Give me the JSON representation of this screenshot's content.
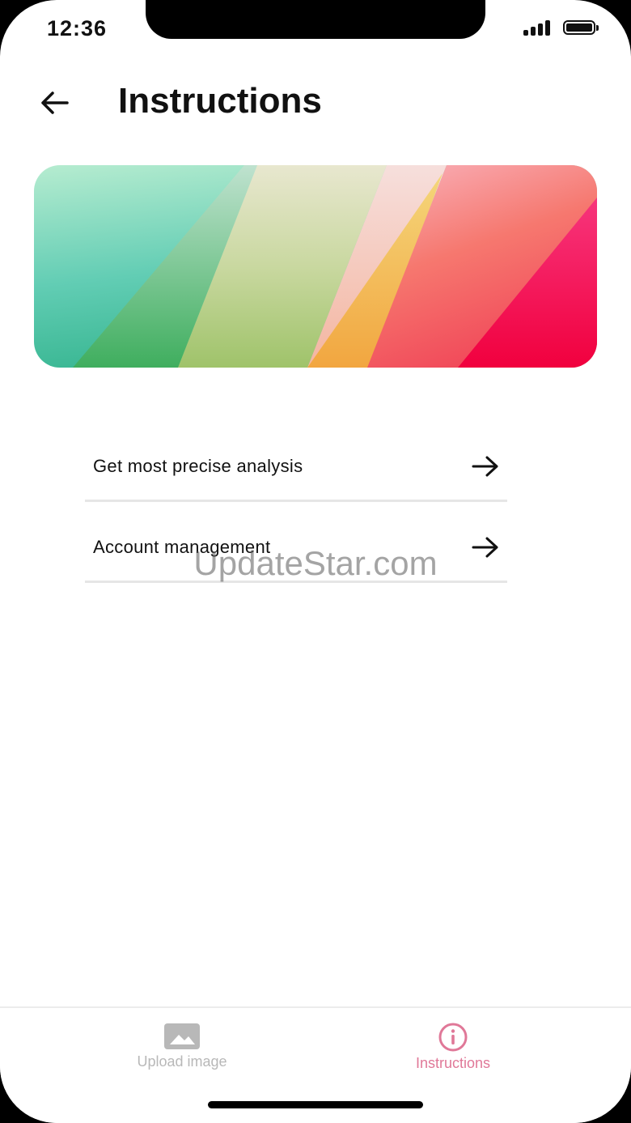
{
  "status_bar": {
    "time": "12:36",
    "signal_icon": "cellular-signal-icon",
    "battery_icon": "battery-full-icon"
  },
  "header": {
    "back_icon": "arrow-left-icon",
    "title": "Instructions"
  },
  "banner": {
    "image": "abstract-gradient-banner"
  },
  "menu": {
    "items": [
      {
        "label": "Get most precise analysis",
        "icon": "arrow-right-icon"
      },
      {
        "label": "Account management",
        "icon": "arrow-right-icon"
      }
    ]
  },
  "watermark": "UpdateStar.com",
  "tab_bar": {
    "tabs": [
      {
        "label": "Upload image",
        "icon": "image-icon",
        "active": false
      },
      {
        "label": "Instructions",
        "icon": "info-circle-icon",
        "active": true
      }
    ],
    "inactive_color": "#b8b8b8",
    "active_color": "#e07898"
  }
}
